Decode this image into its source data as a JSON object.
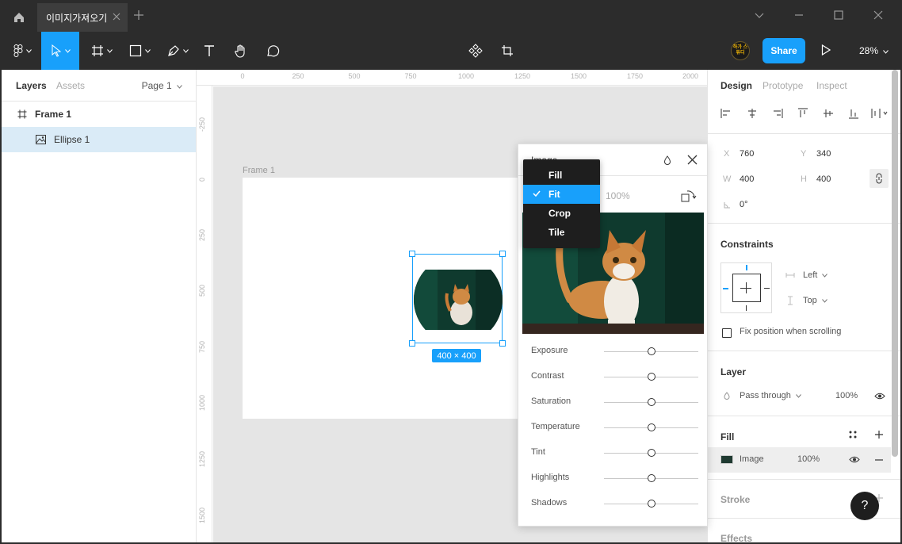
{
  "titlebar": {
    "tab_title": "이미지가져오기",
    "icons": [
      "home-icon",
      "close-icon",
      "plus-icon",
      "chevron-down-icon",
      "minimize-icon",
      "maximize-icon",
      "close-window-icon"
    ]
  },
  "toolbar": {
    "active_tool": "move",
    "avatar_text": "하가 스튜디",
    "share_label": "Share",
    "zoom_label": "28%",
    "colors": {
      "bar": "#2c2c2c",
      "accent": "#18a0fb"
    }
  },
  "left_panel": {
    "tabs": [
      "Layers",
      "Assets"
    ],
    "page_selector": "Page 1",
    "layers": [
      {
        "name": "Frame 1",
        "icon": "frame-icon"
      },
      {
        "name": "Ellipse 1",
        "icon": "image-icon",
        "selected": true
      }
    ]
  },
  "rulers": {
    "horizontal": [
      "0",
      "250",
      "500",
      "750",
      "1000",
      "1250",
      "1500",
      "1750",
      "2000"
    ],
    "vertical": [
      "-250",
      "0",
      "250",
      "500",
      "750",
      "1000",
      "1250",
      "1500"
    ]
  },
  "canvas": {
    "frame_label": "Frame 1",
    "size_badge": "400 × 400"
  },
  "image_popover": {
    "title": "Image",
    "opacity": "100%",
    "scale_menu": {
      "options": [
        "Fill",
        "Fit",
        "Crop",
        "Tile"
      ],
      "selected": "Fit"
    },
    "adjustments": [
      {
        "label": "Exposure",
        "value": 0.5
      },
      {
        "label": "Contrast",
        "value": 0.5
      },
      {
        "label": "Saturation",
        "value": 0.5
      },
      {
        "label": "Temperature",
        "value": 0.5
      },
      {
        "label": "Tint",
        "value": 0.5
      },
      {
        "label": "Highlights",
        "value": 0.5
      },
      {
        "label": "Shadows",
        "value": 0.5
      }
    ]
  },
  "right_panel": {
    "tabs": {
      "design": "Design",
      "prototype": "Prototype",
      "inspect": "Inspect"
    },
    "transform": {
      "x_label": "X",
      "x": "760",
      "y_label": "Y",
      "y": "340",
      "w_label": "W",
      "w": "400",
      "h_label": "H",
      "h": "400",
      "rotation": "0°"
    },
    "constraints": {
      "title": "Constraints",
      "horizontal": "Left",
      "vertical": "Top",
      "fix_position": "Fix position when scrolling"
    },
    "layer": {
      "title": "Layer",
      "blend": "Pass through",
      "opacity": "100%"
    },
    "fill": {
      "title": "Fill",
      "type": "Image",
      "opacity": "100%"
    },
    "stroke": {
      "title": "Stroke"
    },
    "effects": {
      "title": "Effects"
    },
    "help": "?"
  }
}
